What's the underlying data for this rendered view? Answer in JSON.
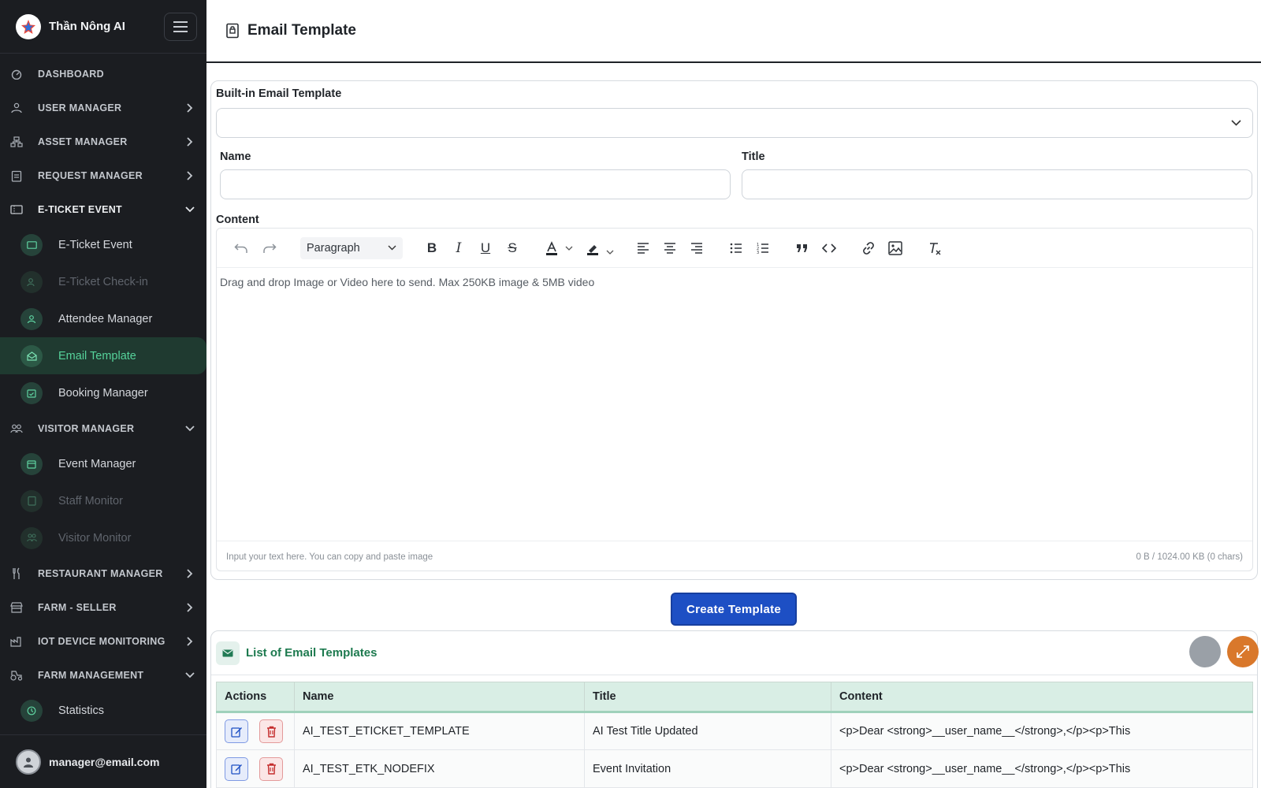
{
  "brand": {
    "name": "Thần Nông AI"
  },
  "sidebar": {
    "items": [
      {
        "label": "DASHBOARD"
      },
      {
        "label": "USER MANAGER"
      },
      {
        "label": "ASSET MANAGER"
      },
      {
        "label": "REQUEST MANAGER"
      },
      {
        "label": "E-TICKET EVENT"
      },
      {
        "label": "VISITOR MANAGER"
      },
      {
        "label": "RESTAURANT MANAGER"
      },
      {
        "label": "FARM - SELLER"
      },
      {
        "label": "IOT DEVICE MONITORING"
      },
      {
        "label": "FARM MANAGEMENT"
      }
    ],
    "eticket_sub": [
      {
        "label": "E-Ticket Event"
      },
      {
        "label": "E-Ticket Check-in"
      },
      {
        "label": "Attendee Manager"
      },
      {
        "label": "Email Template"
      },
      {
        "label": "Booking Manager"
      }
    ],
    "visitor_sub": [
      {
        "label": "Event Manager"
      },
      {
        "label": "Staff Monitor"
      },
      {
        "label": "Visitor Monitor"
      }
    ],
    "farm_sub": [
      {
        "label": "Statistics"
      }
    ]
  },
  "user": {
    "email": "manager@email.com"
  },
  "page": {
    "title": "Email Template"
  },
  "form": {
    "builtin_label": "Built-in Email Template",
    "builtin_value": "",
    "name_label": "Name",
    "name_value": "",
    "title_label": "Title",
    "title_value": "",
    "content_label": "Content",
    "paragraph_label": "Paragraph",
    "editor_placeholder": "Drag and drop Image or Video here to send. Max 250KB image & 5MB video",
    "footer_hint": "Input your text here. You can copy and paste image",
    "footer_size": "0 B / 1024.00 KB (0 chars)",
    "create_label": "Create Template"
  },
  "list": {
    "title": "List of Email Templates",
    "columns": [
      "Actions",
      "Name",
      "Title",
      "Content"
    ],
    "rows": [
      {
        "name": "AI_TEST_ETICKET_TEMPLATE",
        "title": "AI Test Title Updated",
        "content": "<p>Dear <strong>__user_name__</strong>,</p><p>This"
      },
      {
        "name": "AI_TEST_ETK_NODEFIX",
        "title": "Event Invitation",
        "content": "<p>Dear <strong>__user_name__</strong>,</p><p>This"
      }
    ]
  },
  "colors": {
    "accent": "#1d4fc4",
    "active_nav": "#56d39b",
    "sidebar_bg": "#1b1d21",
    "table_header": "#d9eee5"
  }
}
